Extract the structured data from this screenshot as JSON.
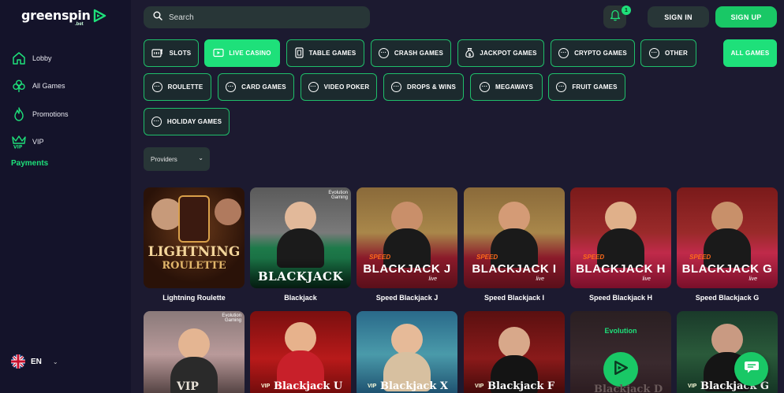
{
  "brand": {
    "name": "greenspin",
    "sub": ".bet"
  },
  "sidebar": {
    "items": [
      {
        "label": "Lobby",
        "icon": "home-icon"
      },
      {
        "label": "All Games",
        "icon": "clover-icon"
      },
      {
        "label": "Promotions",
        "icon": "flame-icon"
      },
      {
        "label": "VIP",
        "icon": "crown-icon"
      }
    ],
    "payments_label": "Payments",
    "language": "EN"
  },
  "search": {
    "placeholder": "Search"
  },
  "header": {
    "notification_count": "1",
    "signin_label": "SIGN IN",
    "signup_label": "SIGN UP"
  },
  "categories": [
    {
      "label": "SLOTS",
      "icon": "slot-icon"
    },
    {
      "label": "LIVE CASINO",
      "icon": "live-icon",
      "active": true
    },
    {
      "label": "TABLE GAMES",
      "icon": "cards-icon"
    },
    {
      "label": "CRASH GAMES",
      "icon": "dots-icon"
    },
    {
      "label": "JACKPOT GAMES",
      "icon": "moneybag-icon"
    },
    {
      "label": "CRYPTO GAMES",
      "icon": "dots-icon"
    },
    {
      "label": "OTHER",
      "icon": "dots-icon"
    },
    {
      "label": "ALL GAMES",
      "icon": "",
      "active": true
    },
    {
      "label": "ROULETTE",
      "icon": "dots-icon"
    },
    {
      "label": "CARD GAMES",
      "icon": "dots-icon"
    },
    {
      "label": "VIDEO POKER",
      "icon": "dots-icon"
    },
    {
      "label": "DROPS & WINS",
      "icon": "dots-icon"
    },
    {
      "label": "MEGAWAYS",
      "icon": "dots-icon"
    },
    {
      "label": "FRUIT GAMES",
      "icon": "dots-icon"
    },
    {
      "label": "HOLIDAY GAMES",
      "icon": "dots-icon"
    }
  ],
  "filters": {
    "providers_label": "Providers"
  },
  "games": [
    {
      "title": "Lightning Roulette",
      "art": "LIGHTNING",
      "art2": "ROULETTE"
    },
    {
      "title": "Blackjack",
      "art": "BLACKJACK",
      "provider_tag": "Evolution Gaming"
    },
    {
      "title": "Speed Blackjack J",
      "art": "BLACKJACK J",
      "tag": "SPEED",
      "live": "live"
    },
    {
      "title": "Speed Blackjack I",
      "art": "BLACKJACK I",
      "tag": "SPEED",
      "live": "live"
    },
    {
      "title": "Speed Blackjack H",
      "art": "BLACKJACK H",
      "tag": "SPEED",
      "live": "live"
    },
    {
      "title": "Speed Blackjack G",
      "art": "BLACKJACK G",
      "tag": "SPEED",
      "live": "live"
    },
    {
      "title": "",
      "art": "VIP",
      "provider_tag": "Evolution Gaming"
    },
    {
      "title": "",
      "art": "Blackjack U",
      "tag": "VIP"
    },
    {
      "title": "",
      "art": "Blackjack X",
      "tag": "VIP"
    },
    {
      "title": "",
      "art": "Blackjack F",
      "tag": "VIP"
    },
    {
      "title": "",
      "art": "Blackjack D",
      "provider": "Evolution"
    },
    {
      "title": "",
      "art": "Blackjack G",
      "tag": "VIP"
    }
  ],
  "colors": {
    "accent": "#1ee07a",
    "sidebar": "#14132a",
    "background": "#1c1a30"
  }
}
